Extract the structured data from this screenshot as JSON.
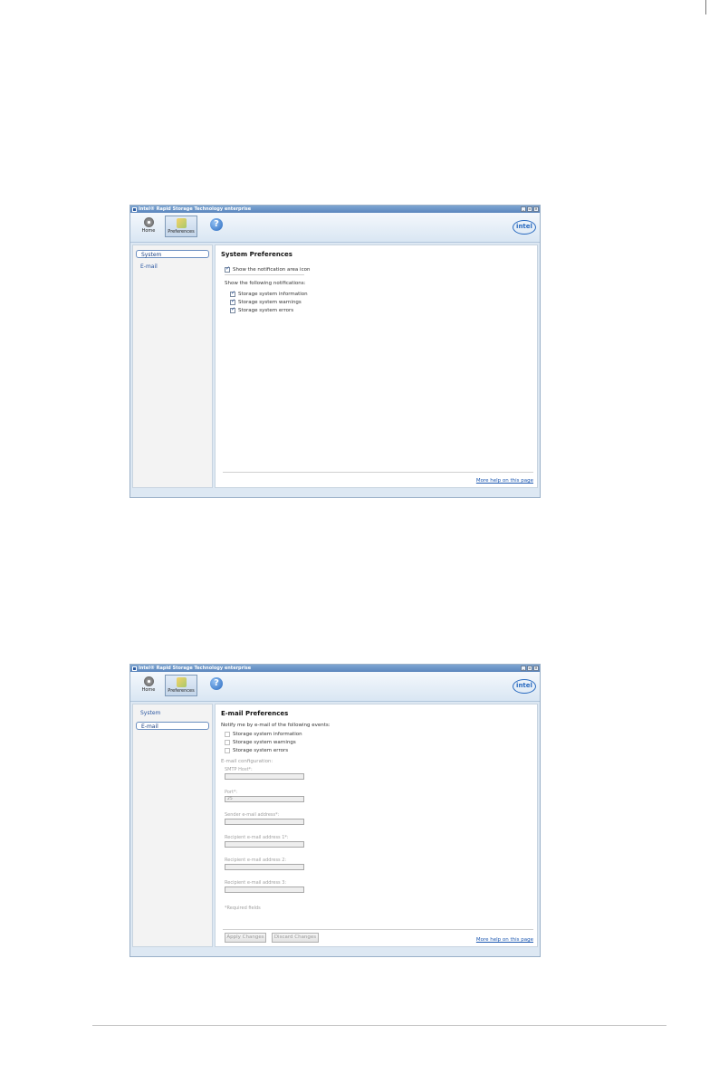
{
  "window_title": "Intel® Rapid Storage Technology enterprise",
  "window_controls": {
    "minimize": "_",
    "restore": "▫",
    "close": "×"
  },
  "toolbar": {
    "home_label": "Home",
    "preferences_label": "Preferences",
    "help_symbol": "?",
    "logo_text": "intel"
  },
  "sidebar": {
    "items": [
      {
        "label": "System"
      },
      {
        "label": "E-mail"
      }
    ]
  },
  "help_link": "More help on this page",
  "system_preferences": {
    "title": "System Preferences",
    "show_icon": {
      "label": "Show the notification area icon",
      "checked": true
    },
    "notifications_label": "Show the following notifications:",
    "notifications": [
      {
        "label": "Storage system information",
        "checked": true
      },
      {
        "label": "Storage system warnings",
        "checked": true
      },
      {
        "label": "Storage system errors",
        "checked": true
      }
    ]
  },
  "email_preferences": {
    "title": "E-mail Preferences",
    "notify_label": "Notify me by e-mail of the following events:",
    "events": [
      {
        "label": "Storage system information",
        "checked": false
      },
      {
        "label": "Storage system warnings",
        "checked": false
      },
      {
        "label": "Storage system errors",
        "checked": false
      }
    ],
    "config_label": "E-mail configuration:",
    "fields": [
      {
        "label": "SMTP Host*:",
        "value": ""
      },
      {
        "label": "Port*:",
        "value": "25"
      },
      {
        "label": "Sender e-mail address*:",
        "value": ""
      },
      {
        "label": "Recipient e-mail address 1*:",
        "value": ""
      },
      {
        "label": "Recipient e-mail address 2:",
        "value": ""
      },
      {
        "label": "Recipient e-mail address 3:",
        "value": ""
      }
    ],
    "required_note": "*Required fields",
    "apply_label": "Apply Changes",
    "discard_label": "Discard Changes"
  }
}
